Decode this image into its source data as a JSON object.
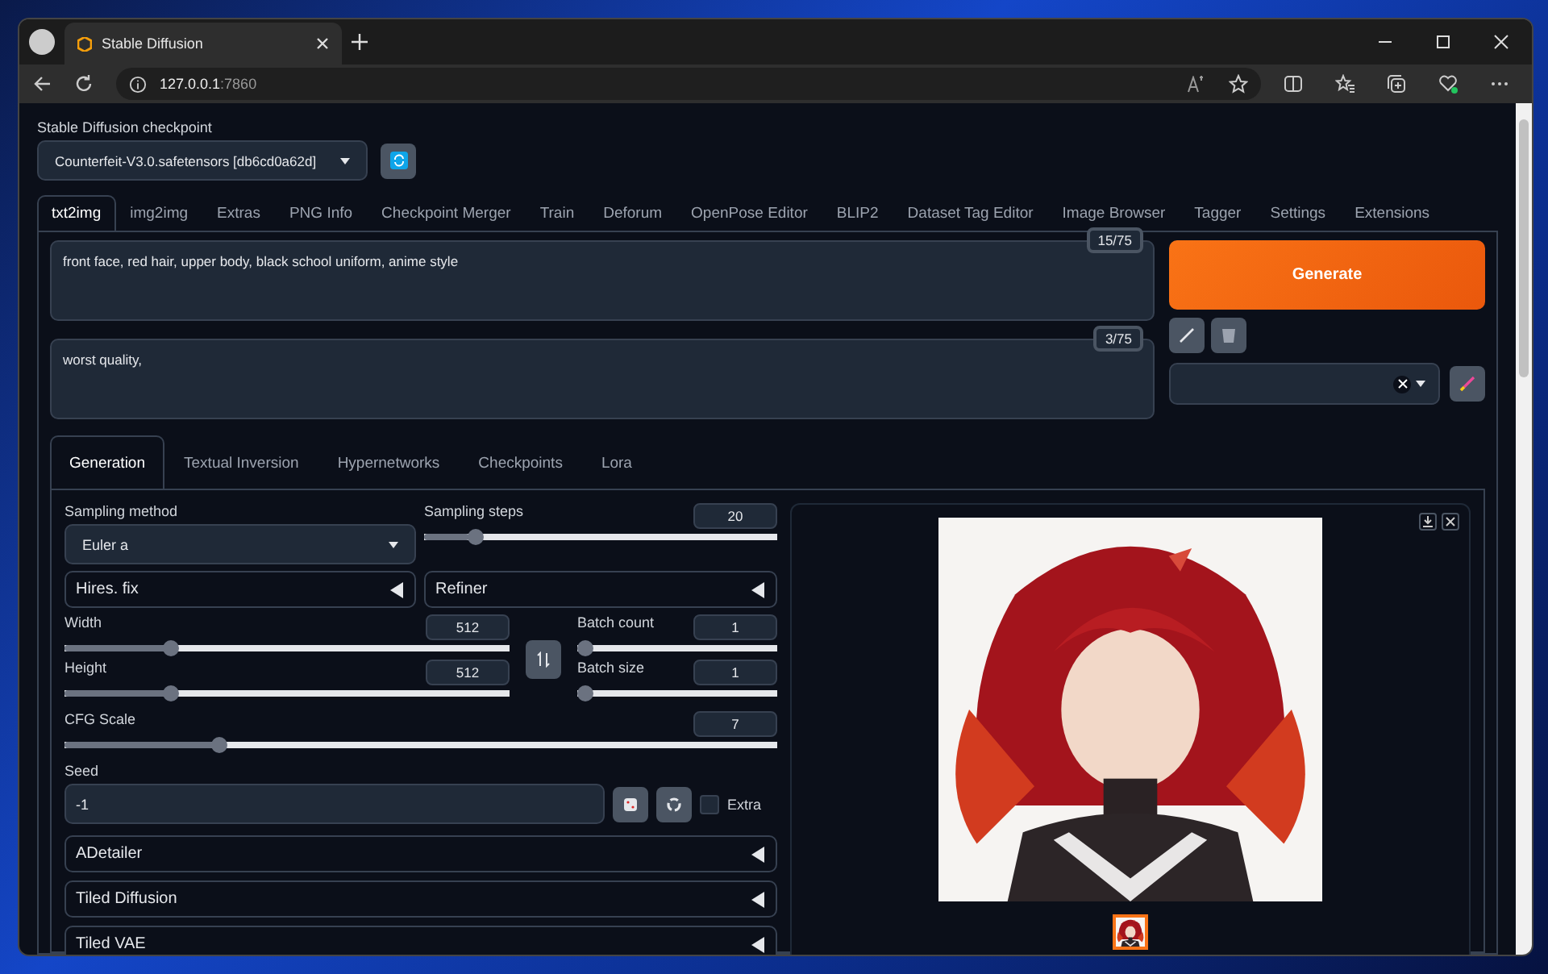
{
  "browser": {
    "tab_title": "Stable Diffusion",
    "address_host": "127.0.0.1",
    "address_port": ":7860"
  },
  "checkpoint": {
    "label": "Stable Diffusion checkpoint",
    "value": "Counterfeit-V3.0.safetensors [db6cd0a62d]"
  },
  "tabs": [
    {
      "label": "txt2img",
      "selected": true
    },
    {
      "label": "img2img",
      "selected": false
    },
    {
      "label": "Extras",
      "selected": false
    },
    {
      "label": "PNG Info",
      "selected": false
    },
    {
      "label": "Checkpoint Merger",
      "selected": false
    },
    {
      "label": "Train",
      "selected": false
    },
    {
      "label": "Deforum",
      "selected": false
    },
    {
      "label": "OpenPose Editor",
      "selected": false
    },
    {
      "label": "BLIP2",
      "selected": false
    },
    {
      "label": "Dataset Tag Editor",
      "selected": false
    },
    {
      "label": "Image Browser",
      "selected": false
    },
    {
      "label": "Tagger",
      "selected": false
    },
    {
      "label": "Settings",
      "selected": false
    },
    {
      "label": "Extensions",
      "selected": false
    }
  ],
  "prompt": {
    "value": "front face, red hair, upper body, black school uniform, anime style",
    "token_count": "15/75"
  },
  "negative_prompt": {
    "value": "worst quality,",
    "token_count": "3/75"
  },
  "generate_button": "Generate",
  "subtabs": [
    {
      "label": "Generation",
      "selected": true
    },
    {
      "label": "Textual Inversion",
      "selected": false
    },
    {
      "label": "Hypernetworks",
      "selected": false
    },
    {
      "label": "Checkpoints",
      "selected": false
    },
    {
      "label": "Lora",
      "selected": false
    }
  ],
  "sampling_method": {
    "label": "Sampling method",
    "value": "Euler a"
  },
  "sampling_steps": {
    "label": "Sampling steps",
    "value": "20",
    "level": 0.13
  },
  "accordions_top": [
    {
      "title": "Hires. fix",
      "expanded": false
    },
    {
      "title": "Refiner",
      "expanded": false
    }
  ],
  "width": {
    "label": "Width",
    "value": "512",
    "level": 0.23
  },
  "height": {
    "label": "Height",
    "value": "512",
    "level": 0.23
  },
  "batch_count": {
    "label": "Batch count",
    "value": "1",
    "level": 0
  },
  "batch_size": {
    "label": "Batch size",
    "value": "1",
    "level": 0
  },
  "cfg_scale": {
    "label": "CFG Scale",
    "value": "7",
    "level": 0.21
  },
  "seed": {
    "label": "Seed",
    "value": "-1"
  },
  "extra": {
    "label": "Extra",
    "checked": false
  },
  "accordions": [
    {
      "title": "ADetailer",
      "expanded": false
    },
    {
      "title": "Tiled Diffusion",
      "expanded": false
    },
    {
      "title": "Tiled VAE",
      "expanded": false
    }
  ],
  "gallery": {
    "thumbnails": [
      {
        "selected": true
      }
    ]
  }
}
